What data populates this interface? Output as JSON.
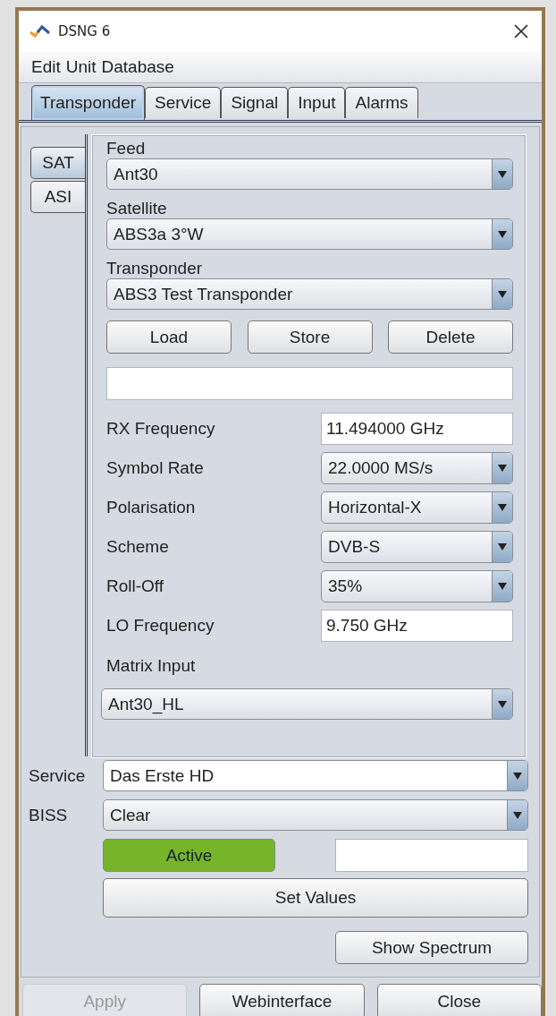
{
  "window": {
    "title": "DSNG 6"
  },
  "menu": [
    "Edit",
    "Unit",
    "Database"
  ],
  "tabs": [
    {
      "label": "Transponder",
      "selected": true
    },
    {
      "label": "Service",
      "selected": false
    },
    {
      "label": "Signal",
      "selected": false
    },
    {
      "label": "Input",
      "selected": false
    },
    {
      "label": "Alarms",
      "selected": false
    }
  ],
  "side_tabs": [
    {
      "label": "SAT",
      "selected": true
    },
    {
      "label": "ASI",
      "selected": false
    }
  ],
  "selectors": [
    {
      "label": "Feed",
      "value": "Ant30"
    },
    {
      "label": "Satellite",
      "value": "ABS3a 3°W"
    },
    {
      "label": "Transponder",
      "value": "ABS3 Test Transponder"
    }
  ],
  "preset_buttons": [
    "Load",
    "Store",
    "Delete"
  ],
  "parameters": [
    {
      "label": "RX Frequency",
      "kind": "text",
      "value": "11.494000 GHz"
    },
    {
      "label": "Symbol Rate",
      "kind": "combo",
      "value": "22.0000 MS/s"
    },
    {
      "label": "Polarisation",
      "kind": "combo",
      "value": "Horizontal-X"
    },
    {
      "label": "Scheme",
      "kind": "combo",
      "value": "DVB-S"
    },
    {
      "label": "Roll-Off",
      "kind": "combo",
      "value": "35%"
    },
    {
      "label": "LO Frequency",
      "kind": "text",
      "value": "9.750 GHz"
    }
  ],
  "matrix_input": {
    "label": "Matrix Input",
    "value": "Ant30_HL"
  },
  "service": {
    "label": "Service",
    "value": "Das Erste HD"
  },
  "biss": {
    "label": "BISS",
    "value": "Clear"
  },
  "status": {
    "label": "Active",
    "on": true
  },
  "set_values": "Set Values",
  "show_spectrum": "Show Spectrum",
  "footer_buttons": [
    {
      "label": "Apply",
      "disabled": true
    },
    {
      "label": "Webinterface",
      "disabled": false
    },
    {
      "label": "Close",
      "disabled": false
    }
  ]
}
